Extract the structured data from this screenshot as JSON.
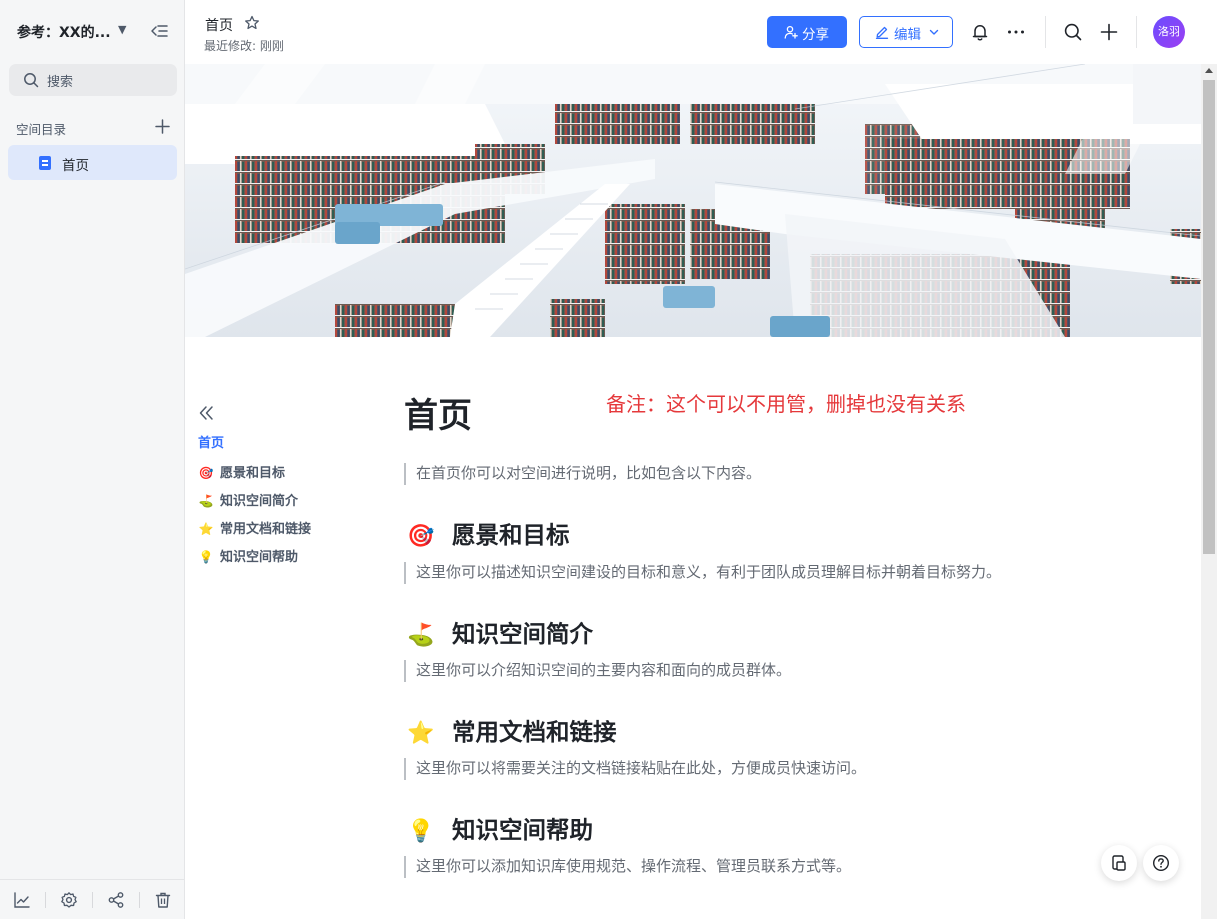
{
  "sidebar": {
    "space_name": "参考：XX的...",
    "search_placeholder": "搜索",
    "directory_label": "空间目录",
    "items": [
      {
        "label": "首页",
        "icon": "doc-icon",
        "selected": true
      }
    ]
  },
  "header": {
    "doc_title": "首页",
    "last_modified": "最近修改: 刚刚",
    "share_label": "分享",
    "edit_label": "编辑",
    "avatar_text": "洛羽",
    "accent_color": "#3370ff"
  },
  "toc": {
    "items": [
      {
        "label": "首页",
        "emoji": "",
        "active": true
      },
      {
        "label": "愿景和目标",
        "emoji": "🎯",
        "active": false
      },
      {
        "label": "知识空间简介",
        "emoji": "⛳",
        "active": false
      },
      {
        "label": "常用文档和链接",
        "emoji": "⭐",
        "active": false
      },
      {
        "label": "知识空间帮助",
        "emoji": "💡",
        "active": false
      }
    ]
  },
  "document": {
    "title": "首页",
    "remark": "备注：这个可以不用管，删掉也没有关系",
    "intro": "在首页你可以对空间进行说明，比如包含以下内容。",
    "sections": [
      {
        "emoji": "🎯",
        "heading": "愿景和目标",
        "text": "这里你可以描述知识空间建设的目标和意义，有利于团队成员理解目标并朝着目标努力。"
      },
      {
        "emoji": "⛳",
        "heading": "知识空间简介",
        "text": "这里你可以介绍知识空间的主要内容和面向的成员群体。"
      },
      {
        "emoji": "⭐",
        "heading": "常用文档和链接",
        "text": "这里你可以将需要关注的文档链接粘贴在此处，方便成员快速访问。"
      },
      {
        "emoji": "💡",
        "heading": "知识空间帮助",
        "text": "这里你可以添加知识库使用规范、操作流程、管理员联系方式等。"
      }
    ]
  }
}
